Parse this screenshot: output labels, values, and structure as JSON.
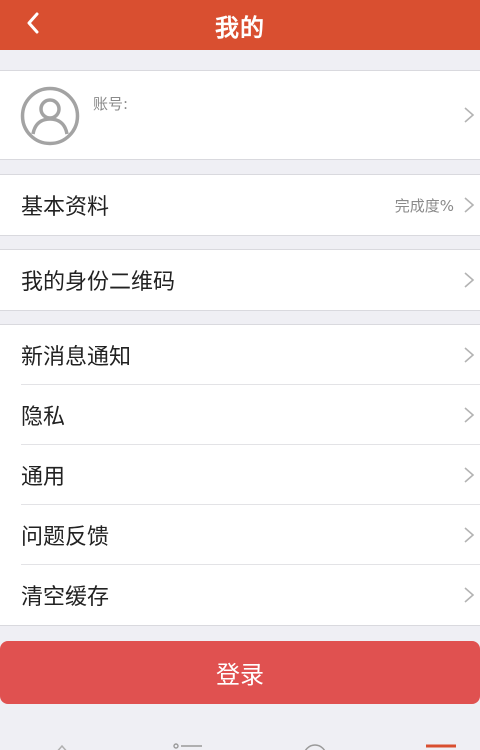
{
  "header": {
    "title": "我的",
    "back_icon": "chevron-left-icon"
  },
  "account": {
    "label": "账号:",
    "avatar_icon": "user-avatar-icon"
  },
  "profile": {
    "label": "基本资料",
    "completion": "完成度%"
  },
  "qrcode": {
    "label": "我的身份二维码"
  },
  "settings": [
    {
      "label": "新消息通知"
    },
    {
      "label": "隐私"
    },
    {
      "label": "通用"
    },
    {
      "label": "问题反馈"
    },
    {
      "label": "清空缓存"
    }
  ],
  "login": {
    "label": "登录"
  },
  "colors": {
    "brand": "#d94f30",
    "login_button": "#e05150",
    "background": "#efeff4"
  }
}
